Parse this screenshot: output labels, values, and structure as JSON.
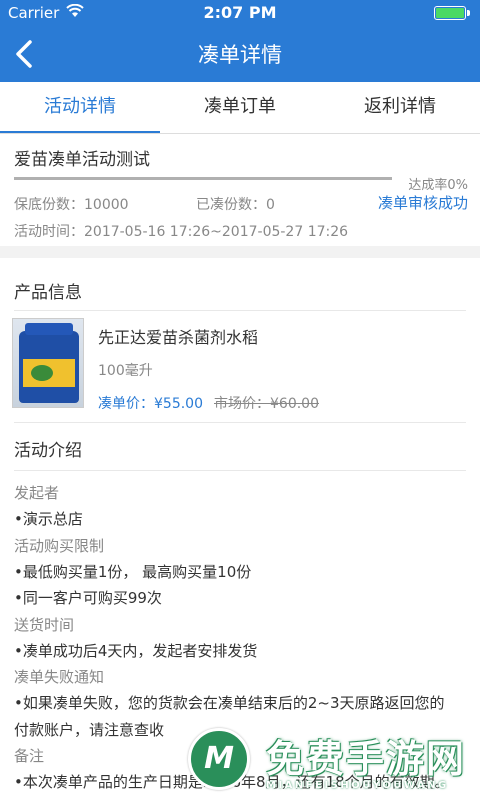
{
  "status_bar": {
    "carrier": "Carrier",
    "time": "2:07 PM"
  },
  "nav": {
    "title": "凑单详情"
  },
  "tabs": [
    {
      "label": "活动详情",
      "active": true
    },
    {
      "label": "凑单订单",
      "active": false
    },
    {
      "label": "返利详情",
      "active": false
    }
  ],
  "activity": {
    "name": "爱苗凑单活动测试",
    "progress_rate_label": "达成率0%",
    "progress_fraction": 0,
    "guarantee_label": "保底份数：",
    "guarantee_value": "10000",
    "collected_label": "已凑份数：",
    "collected_value": "0",
    "status": "凑单审核成功",
    "time_label": "活动时间：",
    "time_value": "2017-05-16 17:26~2017-05-27 17:26"
  },
  "product_section": {
    "title": "产品信息",
    "name": "先正达爱苗杀菌剂水稻",
    "spec": "100毫升",
    "price_label": "凑单价：",
    "price": "¥55.00",
    "market_label": "市场价：",
    "market_price": "¥60.00"
  },
  "intro": {
    "title": "活动介绍",
    "items": [
      {
        "text": "发起者",
        "kind": "label"
      },
      {
        "text": "•演示总店",
        "kind": "value"
      },
      {
        "text": "活动购买限制",
        "kind": "label"
      },
      {
        "text": "•最低购买量1份，  最高购买量10份",
        "kind": "value"
      },
      {
        "text": "•同一客户可购买99次",
        "kind": "value"
      },
      {
        "text": "送货时间",
        "kind": "label"
      },
      {
        "text": "•凑单成功后4天内，发起者安排发货",
        "kind": "value"
      },
      {
        "text": "凑单失败通知",
        "kind": "label"
      },
      {
        "text": "•如果凑单失败，您的货款会在凑单结束后的2~3天原路返回您的",
        "kind": "value"
      },
      {
        "text": "付款账户，请注意查收",
        "kind": "value"
      },
      {
        "text": "备注",
        "kind": "label"
      },
      {
        "text": "•本次凑单产品的生产日期是2016年8月，还有18个月的有效期。",
        "kind": "value"
      }
    ]
  },
  "watermark": {
    "text": "免费手游网",
    "sub": "MIANFEISHOUYOUWANG",
    "logo_letter": "M"
  },
  "colors": {
    "accent": "#2a7bd5",
    "battery": "#4bd964"
  }
}
